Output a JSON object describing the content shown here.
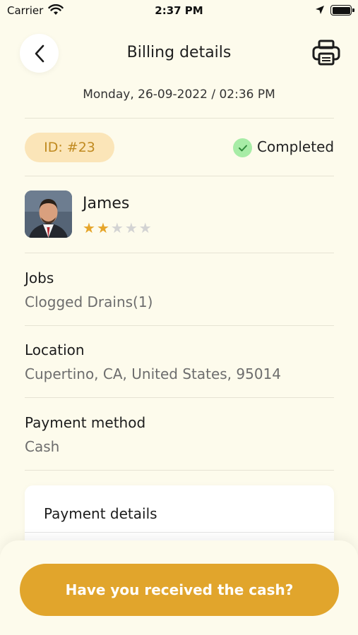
{
  "status_bar": {
    "carrier": "Carrier",
    "time": "2:37 PM"
  },
  "header": {
    "title": "Billing details",
    "back_icon": "chevron-left-icon",
    "print_icon": "printer-icon"
  },
  "date_time": "Monday, 26-09-2022 / 02:36 PM",
  "order": {
    "id": "ID: #23",
    "status": "Completed",
    "status_color": "#a7eca6",
    "id_badge_color": "#fbe5b8"
  },
  "user": {
    "name": "James",
    "rating": 2,
    "rating_max": 5
  },
  "sections": {
    "jobs_label": "Jobs",
    "jobs_value": "Clogged Drains(1)",
    "location_label": "Location",
    "location_value": "Cupertino, CA, United States, 95014",
    "payment_method_label": "Payment method",
    "payment_method_value": "Cash"
  },
  "payment_card": {
    "title": "Payment details"
  },
  "footer": {
    "cash_button_label": "Have you received the cash?",
    "accent_color": "#e1a52c"
  }
}
